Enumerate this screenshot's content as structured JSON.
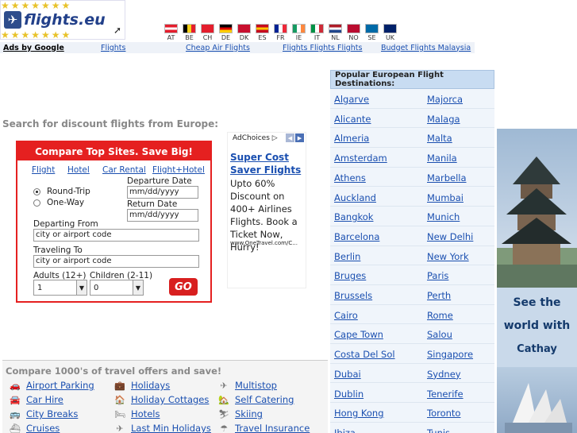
{
  "header": {
    "brand": "flights.eu",
    "stars": "★★★★★★★",
    "flags": [
      {
        "code": "AT",
        "colors": [
          "#e41e2d",
          "#ffffff",
          "#e41e2d"
        ],
        "dir": "h"
      },
      {
        "code": "BE",
        "colors": [
          "#000000",
          "#f8d31b",
          "#e41e2d"
        ],
        "dir": "v"
      },
      {
        "code": "CH",
        "colors": [
          "#e41e2d",
          "#e41e2d",
          "#e41e2d"
        ],
        "dir": "v"
      },
      {
        "code": "DE",
        "colors": [
          "#000000",
          "#dd0000",
          "#ffce00"
        ],
        "dir": "h"
      },
      {
        "code": "DK",
        "colors": [
          "#c8102e",
          "#c8102e",
          "#c8102e"
        ],
        "dir": "v"
      },
      {
        "code": "ES",
        "colors": [
          "#c60b1e",
          "#ffc400",
          "#c60b1e"
        ],
        "dir": "h"
      },
      {
        "code": "FR",
        "colors": [
          "#002395",
          "#ffffff",
          "#ed2939"
        ],
        "dir": "v"
      },
      {
        "code": "IE",
        "colors": [
          "#169b62",
          "#ffffff",
          "#ff883e"
        ],
        "dir": "v"
      },
      {
        "code": "IT",
        "colors": [
          "#009246",
          "#ffffff",
          "#ce2b37"
        ],
        "dir": "v"
      },
      {
        "code": "NL",
        "colors": [
          "#ae1c28",
          "#ffffff",
          "#21468b"
        ],
        "dir": "h"
      },
      {
        "code": "NO",
        "colors": [
          "#ba0c2f",
          "#ba0c2f",
          "#ba0c2f"
        ],
        "dir": "v"
      },
      {
        "code": "SE",
        "colors": [
          "#006aa7",
          "#006aa7",
          "#006aa7"
        ],
        "dir": "v"
      },
      {
        "code": "UK",
        "colors": [
          "#012169",
          "#012169",
          "#012169"
        ],
        "dir": "v"
      }
    ]
  },
  "adsbar": {
    "label": "Ads by Google",
    "links": [
      "Flights",
      "Cheap Air Flights",
      "Flights Flights Flights",
      "Budget Flights Malaysia"
    ]
  },
  "search": {
    "heading": "Search for discount flights from Europe:",
    "title": "Compare Top Sites. Save Big!",
    "tabs": [
      "Flight",
      "Hotel",
      "Car Rental",
      "Flight+Hotel"
    ],
    "trip_types": [
      "Round-Trip",
      "One-Way"
    ],
    "departure_label": "Departure Date",
    "departure_value": "mm/dd/yyyy",
    "return_label": "Return Date",
    "return_value": "mm/dd/yyyy",
    "from_label": "Departing From",
    "from_value": "city or airport code",
    "to_label": "Traveling To",
    "to_value": "city or airport code",
    "adults_label": "Adults (12+)",
    "adults_value": "1",
    "children_label": "Children (2-11)",
    "children_value": "0",
    "go_label": "GO"
  },
  "ad": {
    "adchoices": "AdChoices ▷",
    "headline": "Super Cost Saver Flights",
    "body": "Upto 60% Discount on 400+ Airlines Flights. Book a Ticket Now, Hurry!",
    "url": "www.OneTravel.com/C..."
  },
  "destinations": {
    "heading": "Popular European Flight Destinations:",
    "left": [
      "Algarve",
      "Alicante",
      "Almeria",
      "Amsterdam",
      "Athens",
      "Auckland",
      "Bangkok",
      "Barcelona",
      "Berlin",
      "Bruges",
      "Brussels",
      "Cairo",
      "Cape Town",
      "Costa Del Sol",
      "Dubai",
      "Dublin",
      "Hong Kong",
      "Ibiza"
    ],
    "right": [
      "Majorca",
      "Malaga",
      "Malta",
      "Manila",
      "Marbella",
      "Mumbai",
      "Munich",
      "New Delhi",
      "New York",
      "Paris",
      "Perth",
      "Rome",
      "Salou",
      "Singapore",
      "Sydney",
      "Tenerife",
      "Toronto",
      "Tunis"
    ]
  },
  "banner": {
    "line1": "See the",
    "line2": "world with",
    "brand": "Cathay Pacific"
  },
  "compare": {
    "title": "Compare 1000's of travel offers and save!",
    "col1": [
      "Airport Parking",
      "Car Hire",
      "City Breaks",
      "Cruises"
    ],
    "col2": [
      "Holidays",
      "Holiday Cottages",
      "Hotels",
      "Last Min Holidays"
    ],
    "col3": [
      "Multistop",
      "Self Catering",
      "Skiing",
      "Travel Insurance"
    ]
  }
}
